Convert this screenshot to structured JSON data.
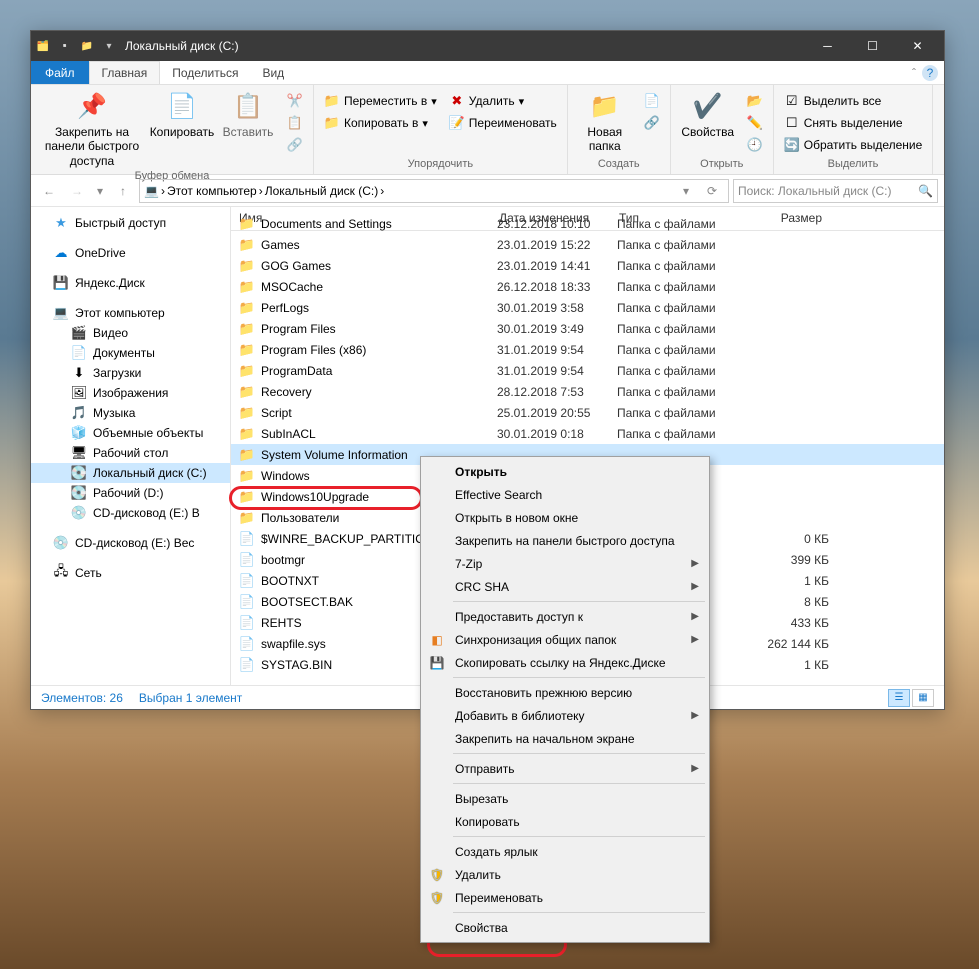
{
  "titlebar": {
    "title": "Локальный диск (C:)"
  },
  "ribbon_tabs": {
    "file": "Файл",
    "home": "Главная",
    "share": "Поделиться",
    "view": "Вид"
  },
  "ribbon": {
    "clipboard": {
      "pin": "Закрепить на панели быстрого доступа",
      "copy": "Копировать",
      "paste": "Вставить",
      "label": "Буфер обмена"
    },
    "organize": {
      "move_to": "Переместить в",
      "copy_to": "Копировать в",
      "delete": "Удалить",
      "rename": "Переименовать",
      "label": "Упорядочить"
    },
    "new": {
      "folder": "Новая папка",
      "label": "Создать"
    },
    "open": {
      "properties": "Свойства",
      "label": "Открыть"
    },
    "select": {
      "all": "Выделить все",
      "none": "Снять выделение",
      "invert": "Обратить выделение",
      "label": "Выделить"
    }
  },
  "breadcrumb": {
    "pc": "Этот компьютер",
    "drive": "Локальный диск (C:)"
  },
  "search": {
    "placeholder": "Поиск: Локальный диск (C:)"
  },
  "nav": {
    "quick": "Быстрый доступ",
    "onedrive": "OneDrive",
    "yandex": "Яндекс.Диск",
    "pc": "Этот компьютер",
    "video": "Видео",
    "docs": "Документы",
    "downloads": "Загрузки",
    "images": "Изображения",
    "music": "Музыка",
    "objects": "Объемные объекты",
    "desktop": "Рабочий стол",
    "drive_c": "Локальный диск (C:)",
    "drive_d": "Рабочий (D:)",
    "cd_e": "CD-дисковод (E:) В",
    "cd_e2": "CD-дисковод (E:) Вес",
    "network": "Сеть"
  },
  "cols": {
    "name": "Имя",
    "date": "Дата изменения",
    "type": "Тип",
    "size": "Размер"
  },
  "type_folder": "Папка с файлами",
  "files": [
    {
      "icon": "folder",
      "name": "Documents and Settings",
      "date": "23.12.2018 10:10",
      "type_key": "type_folder",
      "size": ""
    },
    {
      "icon": "folder",
      "name": "Games",
      "date": "23.01.2019 15:22",
      "type_key": "type_folder",
      "size": ""
    },
    {
      "icon": "folder",
      "name": "GOG Games",
      "date": "23.01.2019 14:41",
      "type_key": "type_folder",
      "size": ""
    },
    {
      "icon": "folder",
      "name": "MSOCache",
      "date": "26.12.2018 18:33",
      "type_key": "type_folder",
      "size": ""
    },
    {
      "icon": "folder",
      "name": "PerfLogs",
      "date": "30.01.2019 3:58",
      "type_key": "type_folder",
      "size": ""
    },
    {
      "icon": "folder",
      "name": "Program Files",
      "date": "30.01.2019 3:49",
      "type_key": "type_folder",
      "size": ""
    },
    {
      "icon": "folder",
      "name": "Program Files (x86)",
      "date": "31.01.2019 9:54",
      "type_key": "type_folder",
      "size": ""
    },
    {
      "icon": "folder",
      "name": "ProgramData",
      "date": "31.01.2019 9:54",
      "type_key": "type_folder",
      "size": ""
    },
    {
      "icon": "folder",
      "name": "Recovery",
      "date": "28.12.2018 7:53",
      "type_key": "type_folder",
      "size": ""
    },
    {
      "icon": "folder",
      "name": "Script",
      "date": "25.01.2019 20:55",
      "type_key": "type_folder",
      "size": ""
    },
    {
      "icon": "folder",
      "name": "SubInACL",
      "date": "30.01.2019 0:18",
      "type_key": "type_folder",
      "size": ""
    },
    {
      "icon": "folder",
      "name": "System Volume Information",
      "date": "",
      "type": "",
      "size": "",
      "selected": true
    },
    {
      "icon": "folder",
      "name": "Windows",
      "date": "",
      "type": "",
      "size": ""
    },
    {
      "icon": "folder",
      "name": "Windows10Upgrade",
      "date": "",
      "type": "",
      "size": ""
    },
    {
      "icon": "folder",
      "name": "Пользователи",
      "date": "",
      "type": "",
      "size": ""
    },
    {
      "icon": "file",
      "name": "$WINRE_BACKUP_PARTITION.MAR",
      "date": "",
      "type": "",
      "size": "0 КБ"
    },
    {
      "icon": "file",
      "name": "bootmgr",
      "date": "",
      "type": "",
      "size": "399 КБ"
    },
    {
      "icon": "file",
      "name": "BOOTNXT",
      "date": "",
      "type": "",
      "size": "1 КБ"
    },
    {
      "icon": "file",
      "name": "BOOTSECT.BAK",
      "date": "",
      "type": "",
      "size": "8 КБ"
    },
    {
      "icon": "file",
      "name": "REHTS",
      "date": "",
      "type": "",
      "size": "433 КБ"
    },
    {
      "icon": "file",
      "name": "swapfile.sys",
      "date": "",
      "type": "",
      "size": "262 144 КБ"
    },
    {
      "icon": "file",
      "name": "SYSTAG.BIN",
      "date": "",
      "type": "",
      "size": "1 КБ"
    }
  ],
  "status": {
    "count": "Элементов: 26",
    "selected": "Выбран 1 элемент"
  },
  "menu": {
    "open": "Открыть",
    "effective": "Effective Search",
    "open_new": "Открыть в новом окне",
    "pin_quick": "Закрепить на панели быстрого доступа",
    "sevenzip": "7-Zip",
    "crc": "CRC SHA",
    "share": "Предоставить доступ к",
    "sync": "Синхронизация общих папок",
    "yandex": "Скопировать ссылку на Яндекс.Диске",
    "restore": "Восстановить прежнюю версию",
    "library": "Добавить в библиотеку",
    "pin_start": "Закрепить на начальном экране",
    "send": "Отправить",
    "cut": "Вырезать",
    "copy": "Копировать",
    "shortcut": "Создать ярлык",
    "delete": "Удалить",
    "rename": "Переименовать",
    "properties": "Свойства"
  }
}
